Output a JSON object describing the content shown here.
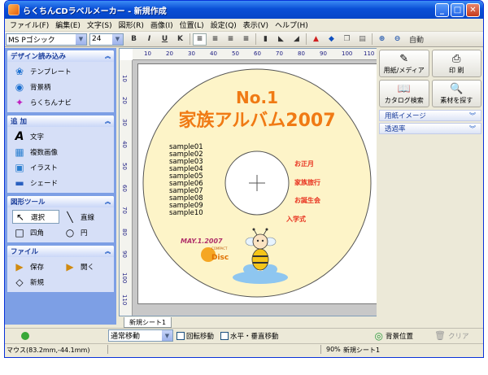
{
  "window": {
    "title": "らくちんCDラベルメーカー - 新規作成"
  },
  "menu": [
    "ファイル(F)",
    "編集(E)",
    "文字(S)",
    "図形(R)",
    "画像(I)",
    "位置(L)",
    "設定(Q)",
    "表示(V)",
    "ヘルプ(H)"
  ],
  "toolbar": {
    "font_name": "MS Pゴシック",
    "font_size": "24",
    "bold": "B",
    "italic": "I",
    "underline": "U",
    "strike": "K",
    "auto_label": "自動"
  },
  "left_panel": {
    "design": {
      "header": "デザイン読み込み",
      "items": [
        "テンプレート",
        "背景柄",
        "らくちんナビ"
      ]
    },
    "add": {
      "header": "追 加",
      "items": [
        "文字",
        "複数画像",
        "イラスト",
        "シェード"
      ]
    },
    "shapes": {
      "header": "図形ツール",
      "select": "選択",
      "line": "直線",
      "rect": "四角",
      "circle": "円"
    },
    "file": {
      "header": "ファイル",
      "save": "保存",
      "open": "開く",
      "new": "新規"
    }
  },
  "ruler": {
    "top": [
      "10",
      "20",
      "30",
      "40",
      "50",
      "60",
      "70",
      "80",
      "90",
      "100",
      "110"
    ],
    "left": [
      "10",
      "20",
      "30",
      "40",
      "50",
      "60",
      "70",
      "80",
      "90",
      "100",
      "110"
    ]
  },
  "disc": {
    "no": "No.1",
    "title": "家族アルバム2007",
    "samples": [
      "sample01",
      "sample02",
      "sample03",
      "sample04",
      "sample05",
      "sample06",
      "sample07",
      "sample08",
      "sample09",
      "sample10"
    ],
    "events": [
      "お正月",
      "家族旅行",
      "お誕生会",
      "入学式"
    ],
    "date": "MAY.1.2007",
    "logo_top": "COMPACT",
    "logo_bottom": "Disc"
  },
  "sheet_tab": "新規シート1",
  "right_panel": {
    "paper_media": "用紙/メディア",
    "print": "印 刷",
    "catalog": "カタログ検索",
    "find_material": "素材を探す",
    "paper_image": "用紙イメージ",
    "transparency": "透過率"
  },
  "bottom": {
    "move_mode": "通常移動",
    "rotate": "回転移動",
    "hv_move": "水平・垂直移動",
    "bg_position": "背景位置",
    "clear": "クリア"
  },
  "status": {
    "mouse": "マウス(83.2mm,-44.1mm)",
    "zoom": "90%",
    "sheet": "新規シート1"
  },
  "colors": {
    "title_orange": "#f07a14",
    "disc_fill": "#fdf4c8",
    "events_red": "#e8321f"
  }
}
